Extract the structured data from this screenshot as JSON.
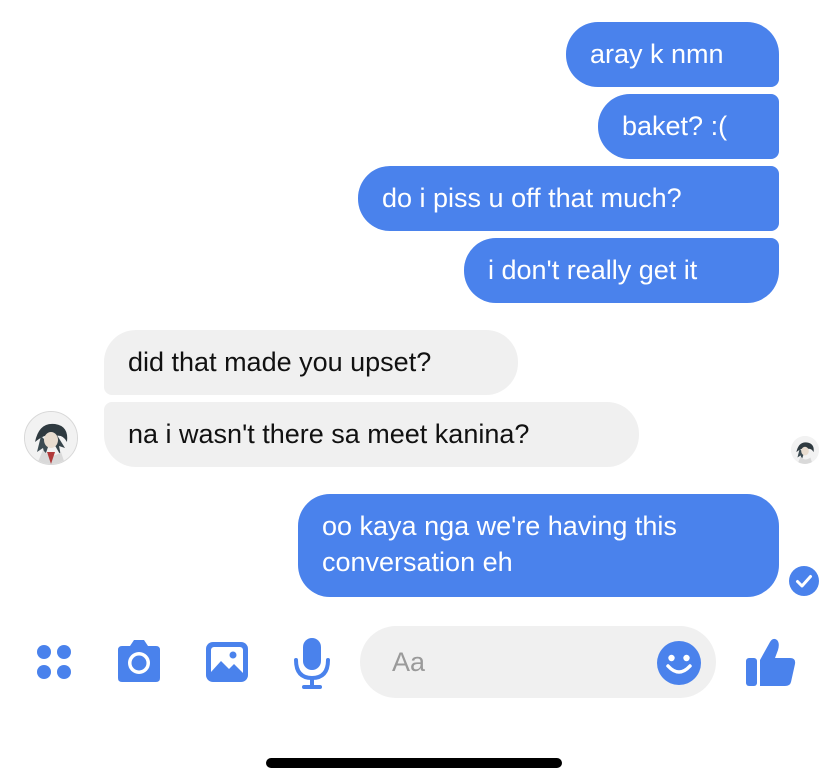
{
  "colors": {
    "accent": "#4a82ec",
    "sent_bubble": "#4a82ec",
    "received_bubble": "#f0f0f0",
    "input_background": "#f0f0f0",
    "placeholder": "#9a9a9a"
  },
  "messages": {
    "sent_1": "aray k nmn",
    "sent_2": "baket? :(",
    "sent_3": "do i piss u off that much?",
    "sent_4": "i don't really get it",
    "received_1": "did that made you upset?",
    "received_2": "na i wasn't there sa meet kanina?",
    "sent_5_line1": "oo kaya nga we're having this",
    "sent_5_line2": "conversation eh"
  },
  "composer": {
    "placeholder": "Aa",
    "icons": [
      "menu-dots-icon",
      "camera-icon",
      "image-icon",
      "microphone-icon",
      "emoji-icon",
      "thumbs-up-icon"
    ]
  }
}
